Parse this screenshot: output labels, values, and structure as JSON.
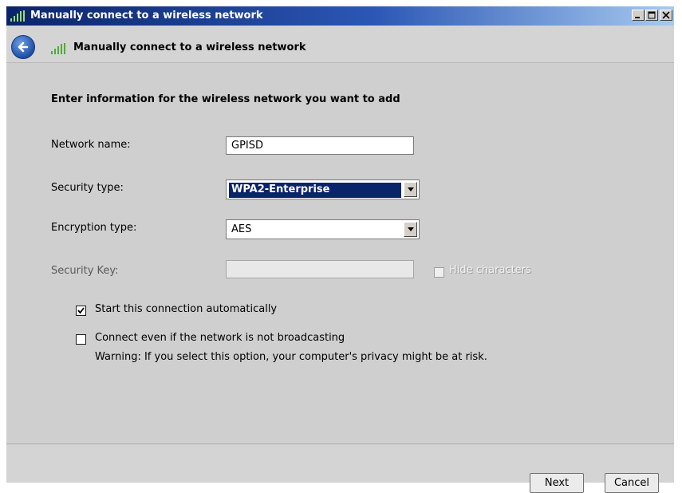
{
  "window": {
    "title": "Manually connect to a wireless network",
    "controls": [
      "minimize",
      "maximize",
      "close"
    ]
  },
  "header": {
    "title": "Manually connect to a wireless network"
  },
  "form": {
    "intro": "Enter information for the wireless network you want to add",
    "network_name": {
      "label": "Network name:",
      "value": "GPISD"
    },
    "security_type": {
      "label": "Security type:",
      "value": "WPA2-Enterprise"
    },
    "encryption_type": {
      "label": "Encryption type:",
      "value": "AES"
    },
    "security_key": {
      "label": "Security Key:",
      "value": "",
      "hide_characters_label": "Hide characters",
      "hide_characters_checked": false
    },
    "start_automatically": {
      "label": "Start this connection automatically",
      "checked": true
    },
    "connect_not_broadcasting": {
      "label": "Connect even if the network is not broadcasting",
      "checked": false
    },
    "warning": "Warning: If you select this option, your computer's privacy might be at risk."
  },
  "buttons": {
    "next": "Next",
    "cancel": "Cancel"
  },
  "colors": {
    "title_bar": "#0a246a",
    "selection": "#0a246a",
    "content_bg": "#cfcfcf"
  }
}
